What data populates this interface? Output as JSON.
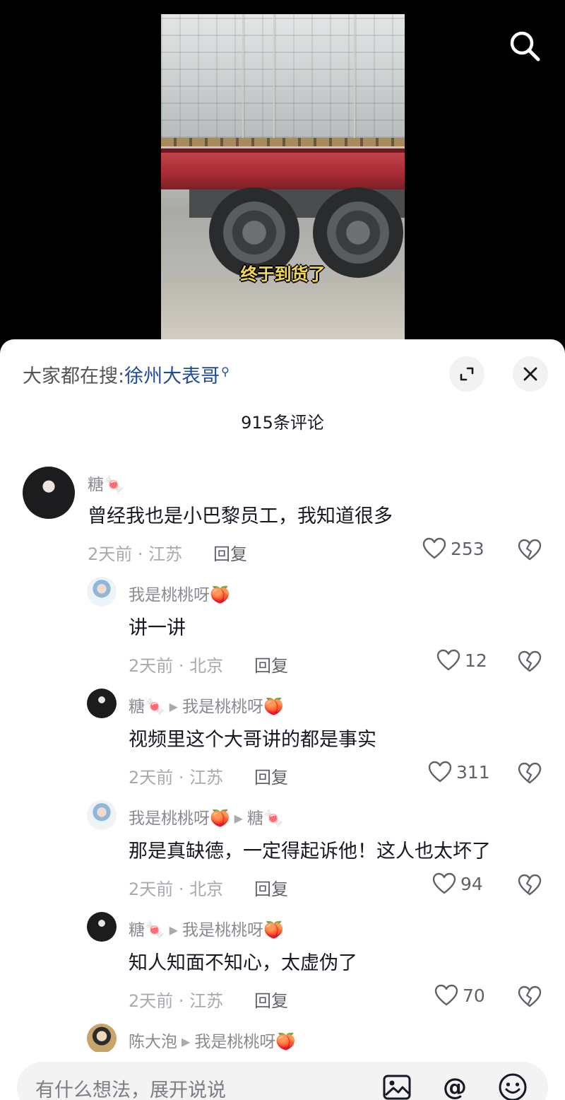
{
  "video": {
    "caption": "终于到货了"
  },
  "sheet": {
    "trending_prefix": "大家都在搜:",
    "trending_term": "徐州大表哥",
    "comment_count": "915条评论"
  },
  "comments": [
    {
      "user": "糖🍬",
      "text": "曾经我也是小巴黎员工，我知道很多",
      "meta": "2天前 · 江苏",
      "reply": "回复",
      "likes": "253"
    },
    {
      "user": "我是桃桃呀🍑",
      "text": "讲一讲",
      "meta": "2天前 · 北京",
      "reply": "回复",
      "likes": "12"
    },
    {
      "user": "糖🍬",
      "reply_to": "我是桃桃呀🍑",
      "text": "视频里这个大哥讲的都是事实",
      "meta": "2天前 · 江苏",
      "reply": "回复",
      "likes": "311"
    },
    {
      "user": "我是桃桃呀🍑",
      "reply_to": "糖🍬",
      "text": "那是真缺德，一定得起诉他！这人也太坏了",
      "meta": "2天前 · 北京",
      "reply": "回复",
      "likes": "94"
    },
    {
      "user": "糖🍬",
      "reply_to": "我是桃桃呀🍑",
      "text": "知人知面不知心，太虚伪了",
      "meta": "2天前 · 江苏",
      "reply": "回复",
      "likes": "70"
    },
    {
      "user": "陈大泡",
      "reply_to": "我是桃桃呀🍑"
    }
  ],
  "input": {
    "placeholder": "有什么想法，展开说说"
  },
  "icons": {
    "search": "search-icon",
    "expand": "expand-icon",
    "close": "close-icon",
    "like": "heart-icon",
    "dislike": "broken-heart-icon",
    "image": "image-icon",
    "mention": "at-icon",
    "emoji": "emoji-icon"
  }
}
